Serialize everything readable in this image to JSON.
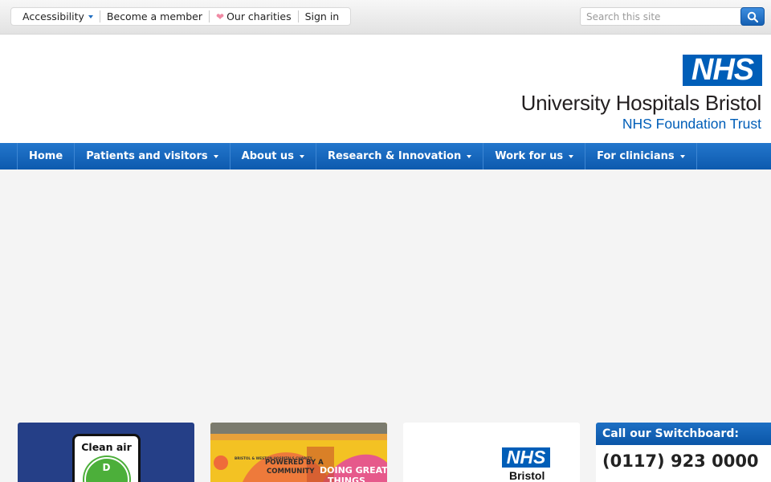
{
  "utility": {
    "accessibility": "Accessibility",
    "member": "Become a member",
    "charities": "Our charities",
    "signin": "Sign in"
  },
  "search": {
    "placeholder": "Search this site"
  },
  "header": {
    "logo": "NHS",
    "org_name": "University Hospitals Bristol",
    "org_sub": "NHS Foundation Trust"
  },
  "nav": {
    "items": [
      {
        "label": "Home"
      },
      {
        "label": "Patients and visitors"
      },
      {
        "label": "About us"
      },
      {
        "label": "Research & Innovation"
      },
      {
        "label": "Work for us"
      },
      {
        "label": "For clinicians"
      }
    ]
  },
  "cards": {
    "clean_air": {
      "label": "Clean air",
      "badge": "D"
    },
    "charity": {
      "line1": "POWERED BY A",
      "line2": "COMMUNITY",
      "line3": "DOING GREAT",
      "line4": "THINGS",
      "brand": "BRISTOL & WESTON HOSPITALS CHARITY"
    },
    "nhs_bristol": {
      "logo": "NHS",
      "text": "Bristol"
    }
  },
  "switchboard": {
    "title": "Call our Switchboard:",
    "number": "(0117) 923 0000"
  },
  "colors": {
    "nhs_blue": "#005eb8",
    "nav_blue": "#1566bd"
  }
}
